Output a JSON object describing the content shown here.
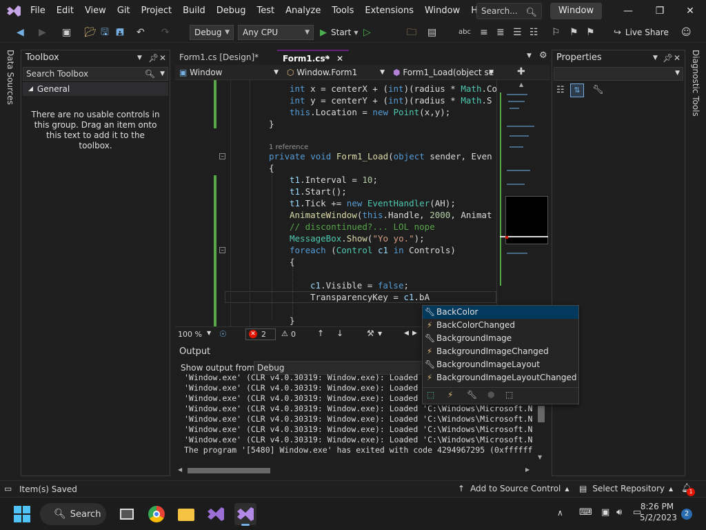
{
  "titlebar": {
    "menu": [
      "File",
      "Edit",
      "View",
      "Git",
      "Project",
      "Build",
      "Debug",
      "Test",
      "Analyze",
      "Tools",
      "Extensions",
      "Window",
      "Help"
    ],
    "search_placeholder": "Search...",
    "solution_name": "Window"
  },
  "toolbar": {
    "config": "Debug",
    "platform": "Any CPU",
    "start_label": "Start",
    "live_share": "Live Share"
  },
  "side": {
    "left_label": "Data Sources",
    "right_label": "Diagnostic Tools"
  },
  "toolbox": {
    "title": "Toolbox",
    "search_placeholder": "Search Toolbox",
    "group": "General",
    "empty_message": "There are no usable controls in this group. Drag an item onto this text to add it to the toolbox."
  },
  "tabs": [
    {
      "label": "Form1.cs [Design]*"
    },
    {
      "label": "Form1.cs*"
    }
  ],
  "navbar": {
    "project": "Window",
    "class": "Window.Form1",
    "member": "Form1_Load(object se"
  },
  "code": {
    "line1": [
      "int",
      " x = centerX + (",
      "int",
      ")(radius * ",
      "Math",
      ".Co"
    ],
    "line2": [
      "int",
      " y = centerY + (",
      "int",
      ")(radius * ",
      "Math",
      ".S"
    ],
    "line3": [
      "this",
      ".Location = ",
      "new",
      " ",
      "Point",
      "(x,y);"
    ],
    "line4": "}",
    "reference": "1 reference",
    "line5": [
      "private",
      " ",
      "void",
      " ",
      "Form1_Load",
      "(",
      "object",
      " sender, Even"
    ],
    "line6": "{",
    "line7": [
      "t1",
      ".Interval = ",
      "10",
      ";"
    ],
    "line8": [
      "t1",
      ".Start();"
    ],
    "line9": [
      "t1",
      ".Tick += ",
      "new",
      " ",
      "EventHandler",
      "(AH);"
    ],
    "line10": [
      "AnimateWindow",
      "(",
      "this",
      ".Handle, ",
      "2000",
      ", Animat"
    ],
    "line11": "// discontinued?... LOL nope",
    "line12": [
      "MessageBox",
      ".",
      "Show",
      "(",
      "\"Yo yo.\"",
      ");"
    ],
    "line13": [
      "foreach",
      " (",
      "Control",
      " ",
      "c1",
      " ",
      "in",
      " Controls)"
    ],
    "line14": "{",
    "line15": [
      "c1",
      ".Visible = ",
      "false",
      ";"
    ],
    "line16": [
      "TransparencyKey",
      " = ",
      "c1",
      ".bA"
    ],
    "line17": "}"
  },
  "editor_status": {
    "zoom": "100 %",
    "errors": "2",
    "warnings": "0"
  },
  "intellisense": {
    "items": [
      {
        "label": "BackColor",
        "icon": "wrench-icon"
      },
      {
        "label": "BackColorChanged",
        "icon": "lightning-icon"
      },
      {
        "label": "BackgroundImage",
        "icon": "wrench-icon"
      },
      {
        "label": "BackgroundImageChanged",
        "icon": "lightning-icon"
      },
      {
        "label": "BackgroundImageLayout",
        "icon": "wrench-icon"
      },
      {
        "label": "BackgroundImageLayoutChanged",
        "icon": "lightning-icon"
      }
    ]
  },
  "output": {
    "title": "Output",
    "show_from_label": "Show output from:",
    "show_from_value": "Debug",
    "lines": [
      "'Window.exe' (CLR v4.0.30319: Window.exe): Loaded",
      "'Window.exe' (CLR v4.0.30319: Window.exe): Loaded",
      "'Window.exe' (CLR v4.0.30319: Window.exe): Loaded",
      "'Window.exe' (CLR v4.0.30319: Window.exe): Loaded 'C:\\Windows\\Microsoft.N",
      "'Window.exe' (CLR v4.0.30319: Window.exe): Loaded 'C:\\Windows\\Microsoft.N",
      "'Window.exe' (CLR v4.0.30319: Window.exe): Loaded 'C:\\Windows\\Microsoft.N",
      "'Window.exe' (CLR v4.0.30319: Window.exe): Loaded 'C:\\Windows\\Microsoft.N",
      "The program '[5480] Window.exe' has exited with code 4294967295 (0xffffff"
    ]
  },
  "properties": {
    "title": "Properties"
  },
  "statusbar": {
    "message": "Item(s) Saved",
    "source_control": "Add to Source Control",
    "repository": "Select Repository",
    "notifications": "1"
  },
  "taskbar": {
    "search": "Search",
    "time": "8:26 PM",
    "date": "5/2/2023",
    "badge": "2"
  },
  "colors": {
    "accent": "#68217a",
    "keyword": "#569cd6",
    "type": "#4ec9b0",
    "error": "#e51400"
  }
}
